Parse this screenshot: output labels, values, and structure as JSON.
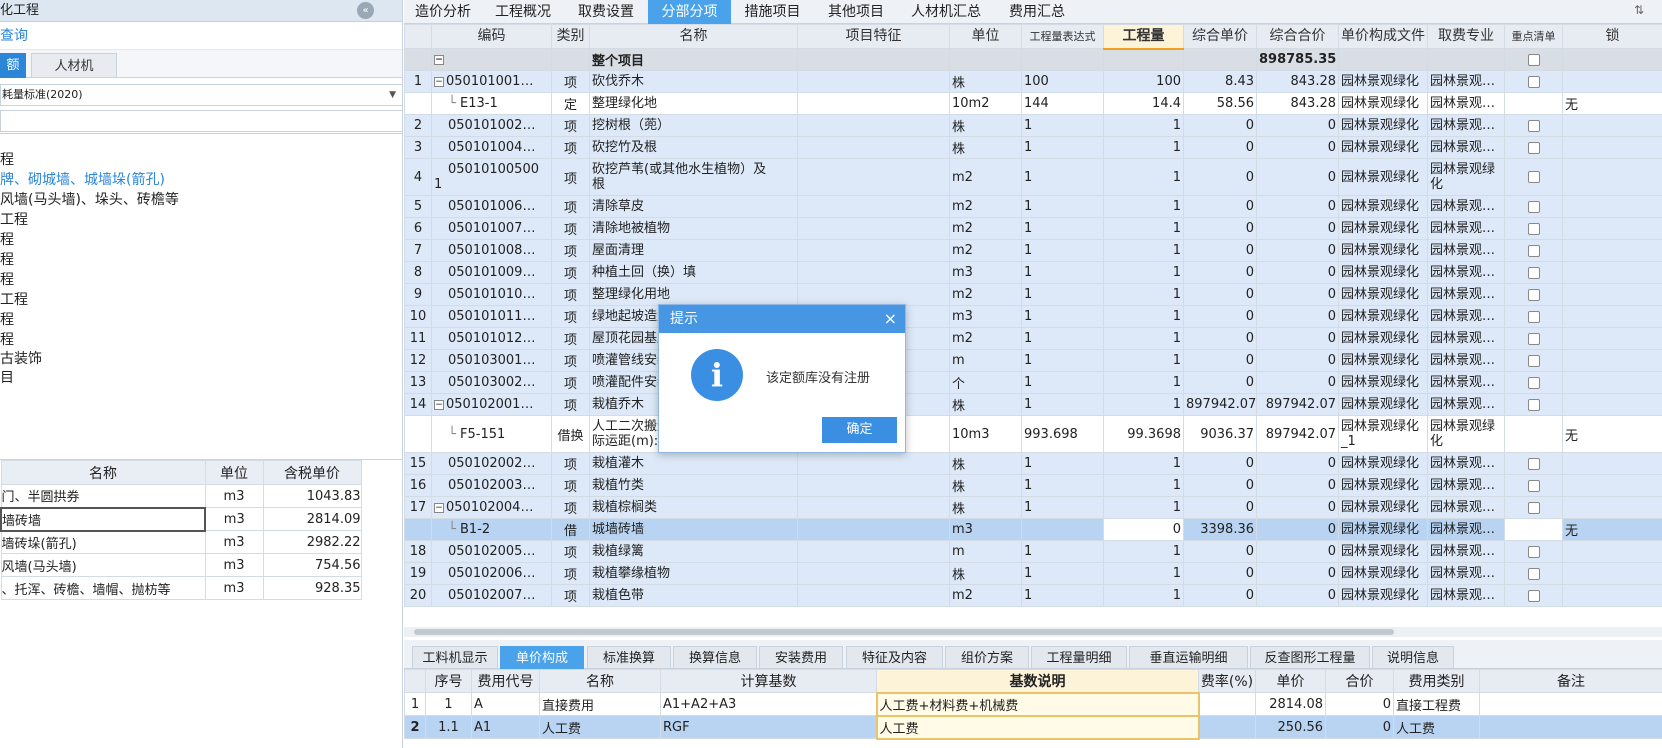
{
  "left_panel": {
    "title": "化工程",
    "search_label": "查询",
    "tabs": [
      "额",
      "人材机"
    ],
    "library_select": "耗量标准(2020)",
    "tree": [
      {
        "label": "程",
        "selected": false
      },
      {
        "label": "牌、砌城墙、城墙垛(箭孔)",
        "selected": true
      },
      {
        "label": "风墙(马头墙)、垛头、砖檐等",
        "selected": false
      },
      {
        "label": "工程",
        "selected": false
      },
      {
        "label": "程",
        "selected": false
      },
      {
        "label": "程",
        "selected": false
      },
      {
        "label": "程",
        "selected": false
      },
      {
        "label": "工程",
        "selected": false
      },
      {
        "label": "程",
        "selected": false
      },
      {
        "label": "程",
        "selected": false
      },
      {
        "label": "古装饰",
        "selected": false
      },
      {
        "label": "目",
        "selected": false
      }
    ],
    "grid_headers": [
      "名称",
      "单位",
      "含税单价"
    ],
    "grid_rows": [
      [
        "门、半圆拱券",
        "m3",
        "1043.83"
      ],
      [
        "墙砖墙",
        "m3",
        "2814.09"
      ],
      [
        "墙砖垛(箭孔)",
        "m3",
        "2982.22"
      ],
      [
        "风墙(马头墙)",
        "m3",
        "754.56"
      ],
      [
        "、托浑、砖檐、墙帽、抛枋等",
        "m3",
        "928.35"
      ]
    ]
  },
  "main_tabs": [
    "造价分析",
    "工程概况",
    "取费设置",
    "分部分项",
    "措施项目",
    "其他项目",
    "人材机汇总",
    "费用汇总"
  ],
  "grid": {
    "headers": [
      "",
      "编码",
      "类别",
      "名称",
      "项目特征",
      "单位",
      "工程量表达式",
      "工程量",
      "综合单价",
      "综合合价",
      "单价构成文件",
      "取费专业",
      "重点清单",
      "锁"
    ],
    "summary": {
      "label": "整个项目",
      "total": "898785.35"
    },
    "rows": [
      {
        "no": "1",
        "code": "050101001…",
        "type": "项",
        "name": "砍伐乔木",
        "unit": "株",
        "expr": "100",
        "qty": "100",
        "price": "8.43",
        "total": "843.28",
        "file": "园林景观绿化",
        "spec": "园林景观…",
        "toggle": "−",
        "indent": 0
      },
      {
        "no": "",
        "code": "E13-1",
        "type": "定",
        "name": "整理绿化地",
        "unit": "10m2",
        "expr": "144",
        "qty": "14.4",
        "price": "58.56",
        "total": "843.28",
        "file": "园林景观绿化",
        "spec": "园林景观…",
        "extra": "无",
        "indent": 1,
        "white": true
      },
      {
        "no": "2",
        "code": "050101002…",
        "type": "项",
        "name": "挖树根（蔸）",
        "unit": "株",
        "expr": "1",
        "qty": "1",
        "price": "0",
        "total": "0",
        "file": "园林景观绿化",
        "spec": "园林景观…",
        "indent": 0
      },
      {
        "no": "3",
        "code": "050101004…",
        "type": "项",
        "name": "砍挖竹及根",
        "unit": "株",
        "expr": "1",
        "qty": "1",
        "price": "0",
        "total": "0",
        "file": "园林景观绿化",
        "spec": "园林景观…",
        "indent": 0
      },
      {
        "no": "4",
        "code": "05010100500\n1",
        "type": "项",
        "name": "砍挖芦苇(或其他水生植物）及\n根",
        "unit": "m2",
        "expr": "1",
        "qty": "1",
        "price": "0",
        "total": "0",
        "file": "园林景观绿化",
        "spec": "园林景观绿\n化",
        "indent": 0,
        "tall": true
      },
      {
        "no": "5",
        "code": "050101006…",
        "type": "项",
        "name": "清除草皮",
        "unit": "m2",
        "expr": "1",
        "qty": "1",
        "price": "0",
        "total": "0",
        "file": "园林景观绿化",
        "spec": "园林景观…",
        "indent": 0
      },
      {
        "no": "6",
        "code": "050101007…",
        "type": "项",
        "name": "清除地被植物",
        "unit": "m2",
        "expr": "1",
        "qty": "1",
        "price": "0",
        "total": "0",
        "file": "园林景观绿化",
        "spec": "园林景观…",
        "indent": 0
      },
      {
        "no": "7",
        "code": "050101008…",
        "type": "项",
        "name": "屋面清理",
        "unit": "m2",
        "expr": "1",
        "qty": "1",
        "price": "0",
        "total": "0",
        "file": "园林景观绿化",
        "spec": "园林景观…",
        "indent": 0
      },
      {
        "no": "8",
        "code": "050101009…",
        "type": "项",
        "name": "种植土回（换）填",
        "unit": "m3",
        "expr": "1",
        "qty": "1",
        "price": "0",
        "total": "0",
        "file": "园林景观绿化",
        "spec": "园林景观…",
        "indent": 0
      },
      {
        "no": "9",
        "code": "050101010…",
        "type": "项",
        "name": "整理绿化用地",
        "unit": "m2",
        "expr": "1",
        "qty": "1",
        "price": "0",
        "total": "0",
        "file": "园林景观绿化",
        "spec": "园林景观…",
        "indent": 0
      },
      {
        "no": "10",
        "code": "050101011…",
        "type": "项",
        "name": "绿地起坡造型",
        "unit": "m3",
        "expr": "1",
        "qty": "1",
        "price": "0",
        "total": "0",
        "file": "园林景观绿化",
        "spec": "园林景观…",
        "indent": 0
      },
      {
        "no": "11",
        "code": "050101012…",
        "type": "项",
        "name": "屋顶花园基底",
        "unit": "m2",
        "expr": "1",
        "qty": "1",
        "price": "0",
        "total": "0",
        "file": "园林景观绿化",
        "spec": "园林景观…",
        "indent": 0
      },
      {
        "no": "12",
        "code": "050103001…",
        "type": "项",
        "name": "喷灌管线安装",
        "unit": "m",
        "expr": "1",
        "qty": "1",
        "price": "0",
        "total": "0",
        "file": "园林景观绿化",
        "spec": "园林景观…",
        "indent": 0
      },
      {
        "no": "13",
        "code": "050103002…",
        "type": "项",
        "name": "喷灌配件安装",
        "unit": "个",
        "expr": "1",
        "qty": "1",
        "price": "0",
        "total": "0",
        "file": "园林景观绿化",
        "spec": "园林景观…",
        "indent": 0
      },
      {
        "no": "14",
        "code": "050102001…",
        "type": "项",
        "name": "栽植乔木",
        "unit": "株",
        "expr": "1",
        "qty": "1",
        "price": "897942.07",
        "total": "897942.07",
        "file": "园林景观绿化",
        "spec": "园林景观…",
        "toggle": "−",
        "indent": 0
      },
      {
        "no": "",
        "code": "F5-151",
        "type": "借换",
        "name": "人工二次搬运\n际运距(m):50",
        "unit": "10m3",
        "expr": "993.698",
        "qty": "99.3698",
        "price": "9036.37",
        "total": "897942.07",
        "file": "园林景观绿化\n_1",
        "spec": "园林景观绿\n化",
        "extra": "无",
        "indent": 1,
        "white": true,
        "tall": true
      },
      {
        "no": "15",
        "code": "050102002…",
        "type": "项",
        "name": "栽植灌木",
        "unit": "株",
        "expr": "1",
        "qty": "1",
        "price": "0",
        "total": "0",
        "file": "园林景观绿化",
        "spec": "园林景观…",
        "indent": 0
      },
      {
        "no": "16",
        "code": "050102003…",
        "type": "项",
        "name": "栽植竹类",
        "unit": "株",
        "expr": "1",
        "qty": "1",
        "price": "0",
        "total": "0",
        "file": "园林景观绿化",
        "spec": "园林景观…",
        "indent": 0
      },
      {
        "no": "17",
        "code": "050102004…",
        "type": "项",
        "name": "栽植棕榈类",
        "unit": "株",
        "expr": "1",
        "qty": "1",
        "price": "0",
        "total": "0",
        "file": "园林景观绿化",
        "spec": "园林景观…",
        "toggle": "−",
        "indent": 0
      },
      {
        "no": "",
        "code": "B1-2",
        "type": "借",
        "name": "城墙砖墙",
        "unit": "m3",
        "expr": "",
        "qty": "0",
        "price": "3398.36",
        "total": "0",
        "file": "园林景观绿化",
        "spec": "园林景观…",
        "extra": "无",
        "indent": 1,
        "highlight": true
      },
      {
        "no": "18",
        "code": "050102005…",
        "type": "项",
        "name": "栽植绿篱",
        "unit": "m",
        "expr": "1",
        "qty": "1",
        "price": "0",
        "total": "0",
        "file": "园林景观绿化",
        "spec": "园林景观…",
        "indent": 0
      },
      {
        "no": "19",
        "code": "050102006…",
        "type": "项",
        "name": "栽植攀缘植物",
        "unit": "株",
        "expr": "1",
        "qty": "1",
        "price": "0",
        "total": "0",
        "file": "园林景观绿化",
        "spec": "园林景观…",
        "indent": 0
      },
      {
        "no": "20",
        "code": "050102007…",
        "type": "项",
        "name": "栽植色带",
        "unit": "m2",
        "expr": "1",
        "qty": "1",
        "price": "0",
        "total": "0",
        "file": "园林景观绿化",
        "spec": "园林景观…",
        "indent": 0
      }
    ]
  },
  "bottom_tabs": [
    "工料机显示",
    "单价构成",
    "标准换算",
    "换算信息",
    "安装费用",
    "特征及内容",
    "组价方案",
    "工程量明细",
    "垂直运输明细",
    "反查图形工程量",
    "说明信息"
  ],
  "bottom_active": 1,
  "bottom_grid": {
    "headers": [
      "",
      "序号",
      "费用代号",
      "名称",
      "计算基数",
      "基数说明",
      "费率(%)",
      "单价",
      "合价",
      "费用类别",
      "备注"
    ],
    "rows": [
      [
        "1",
        "1",
        "A",
        "直接费用",
        "A1+A2+A3",
        "人工费+材料费+机械费",
        "",
        "2814.08",
        "0",
        "直接工程费",
        ""
      ],
      [
        "2",
        "1.1",
        "A1",
        "人工费",
        "RGF",
        "人工费",
        "",
        "250.56",
        "0",
        "人工费",
        ""
      ]
    ]
  },
  "dialog": {
    "title": "提示",
    "message": "该定额库没有注册",
    "ok": "确定",
    "close": "×",
    "icon": "i"
  },
  "colors": {
    "accent": "#4aa3ea",
    "dialog_blue": "#3a8fe3",
    "row_blue": "#dde9f8",
    "highlight": "#b9d4f2"
  }
}
